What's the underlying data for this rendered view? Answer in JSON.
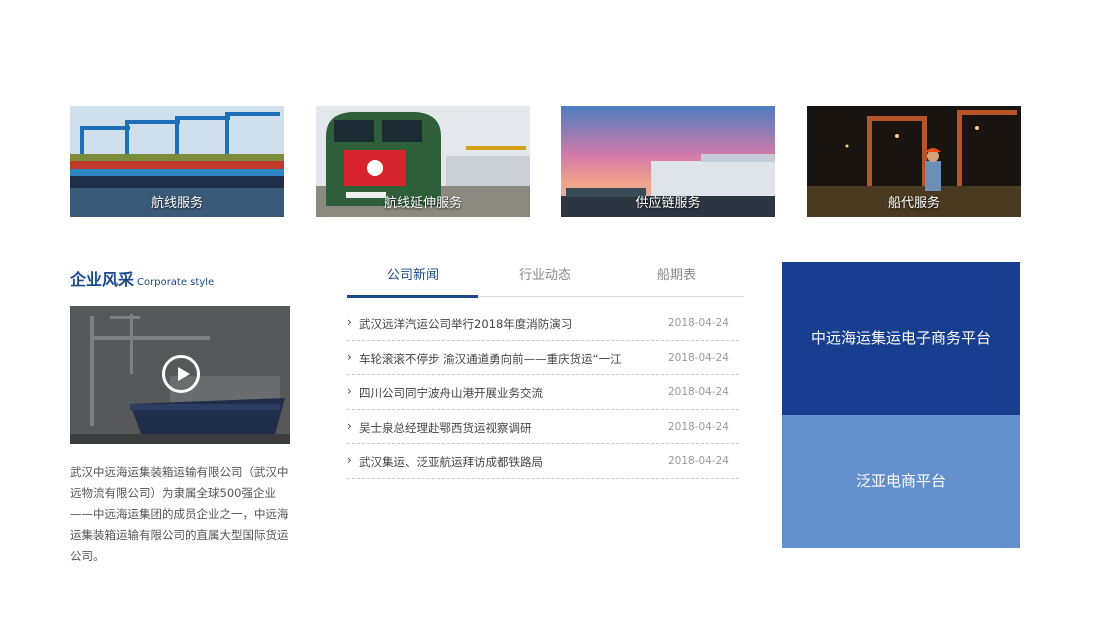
{
  "services": [
    {
      "label": "航线服务"
    },
    {
      "label": "航线延伸服务"
    },
    {
      "label": "供应链服务"
    },
    {
      "label": "船代服务"
    }
  ],
  "corporate": {
    "title": "企业风采",
    "subtitle": "Corporate style",
    "description": "武汉中远海运集装箱运输有限公司（武汉中远物流有限公司）为隶属全球500强企业——中远海运集团的成员企业之一，中远海运集装箱运输有限公司的直属大型国际货运公司。"
  },
  "news": {
    "tabs": [
      {
        "label": "公司新闻"
      },
      {
        "label": "行业动态"
      },
      {
        "label": "船期表"
      }
    ],
    "items": [
      {
        "title": "武汉远洋汽运公司举行2018年度消防演习",
        "date": "2018-04-24"
      },
      {
        "title": "车轮滚滚不停步 渝汉通道勇向前——重庆货运“一江",
        "date": "2018-04-24"
      },
      {
        "title": "四川公司同宁波舟山港开展业务交流",
        "date": "2018-04-24"
      },
      {
        "title": "吴士泉总经理赴鄂西货运视察调研",
        "date": "2018-04-24"
      },
      {
        "title": "武汉集运、泛亚航运拜访成都铁路局",
        "date": "2018-04-24"
      }
    ]
  },
  "platforms": [
    {
      "label": "中远海运集运电子商务平台"
    },
    {
      "label": "泛亚电商平台"
    }
  ],
  "colors": {
    "primary": "#183f8f",
    "secondary": "#6390cc"
  }
}
